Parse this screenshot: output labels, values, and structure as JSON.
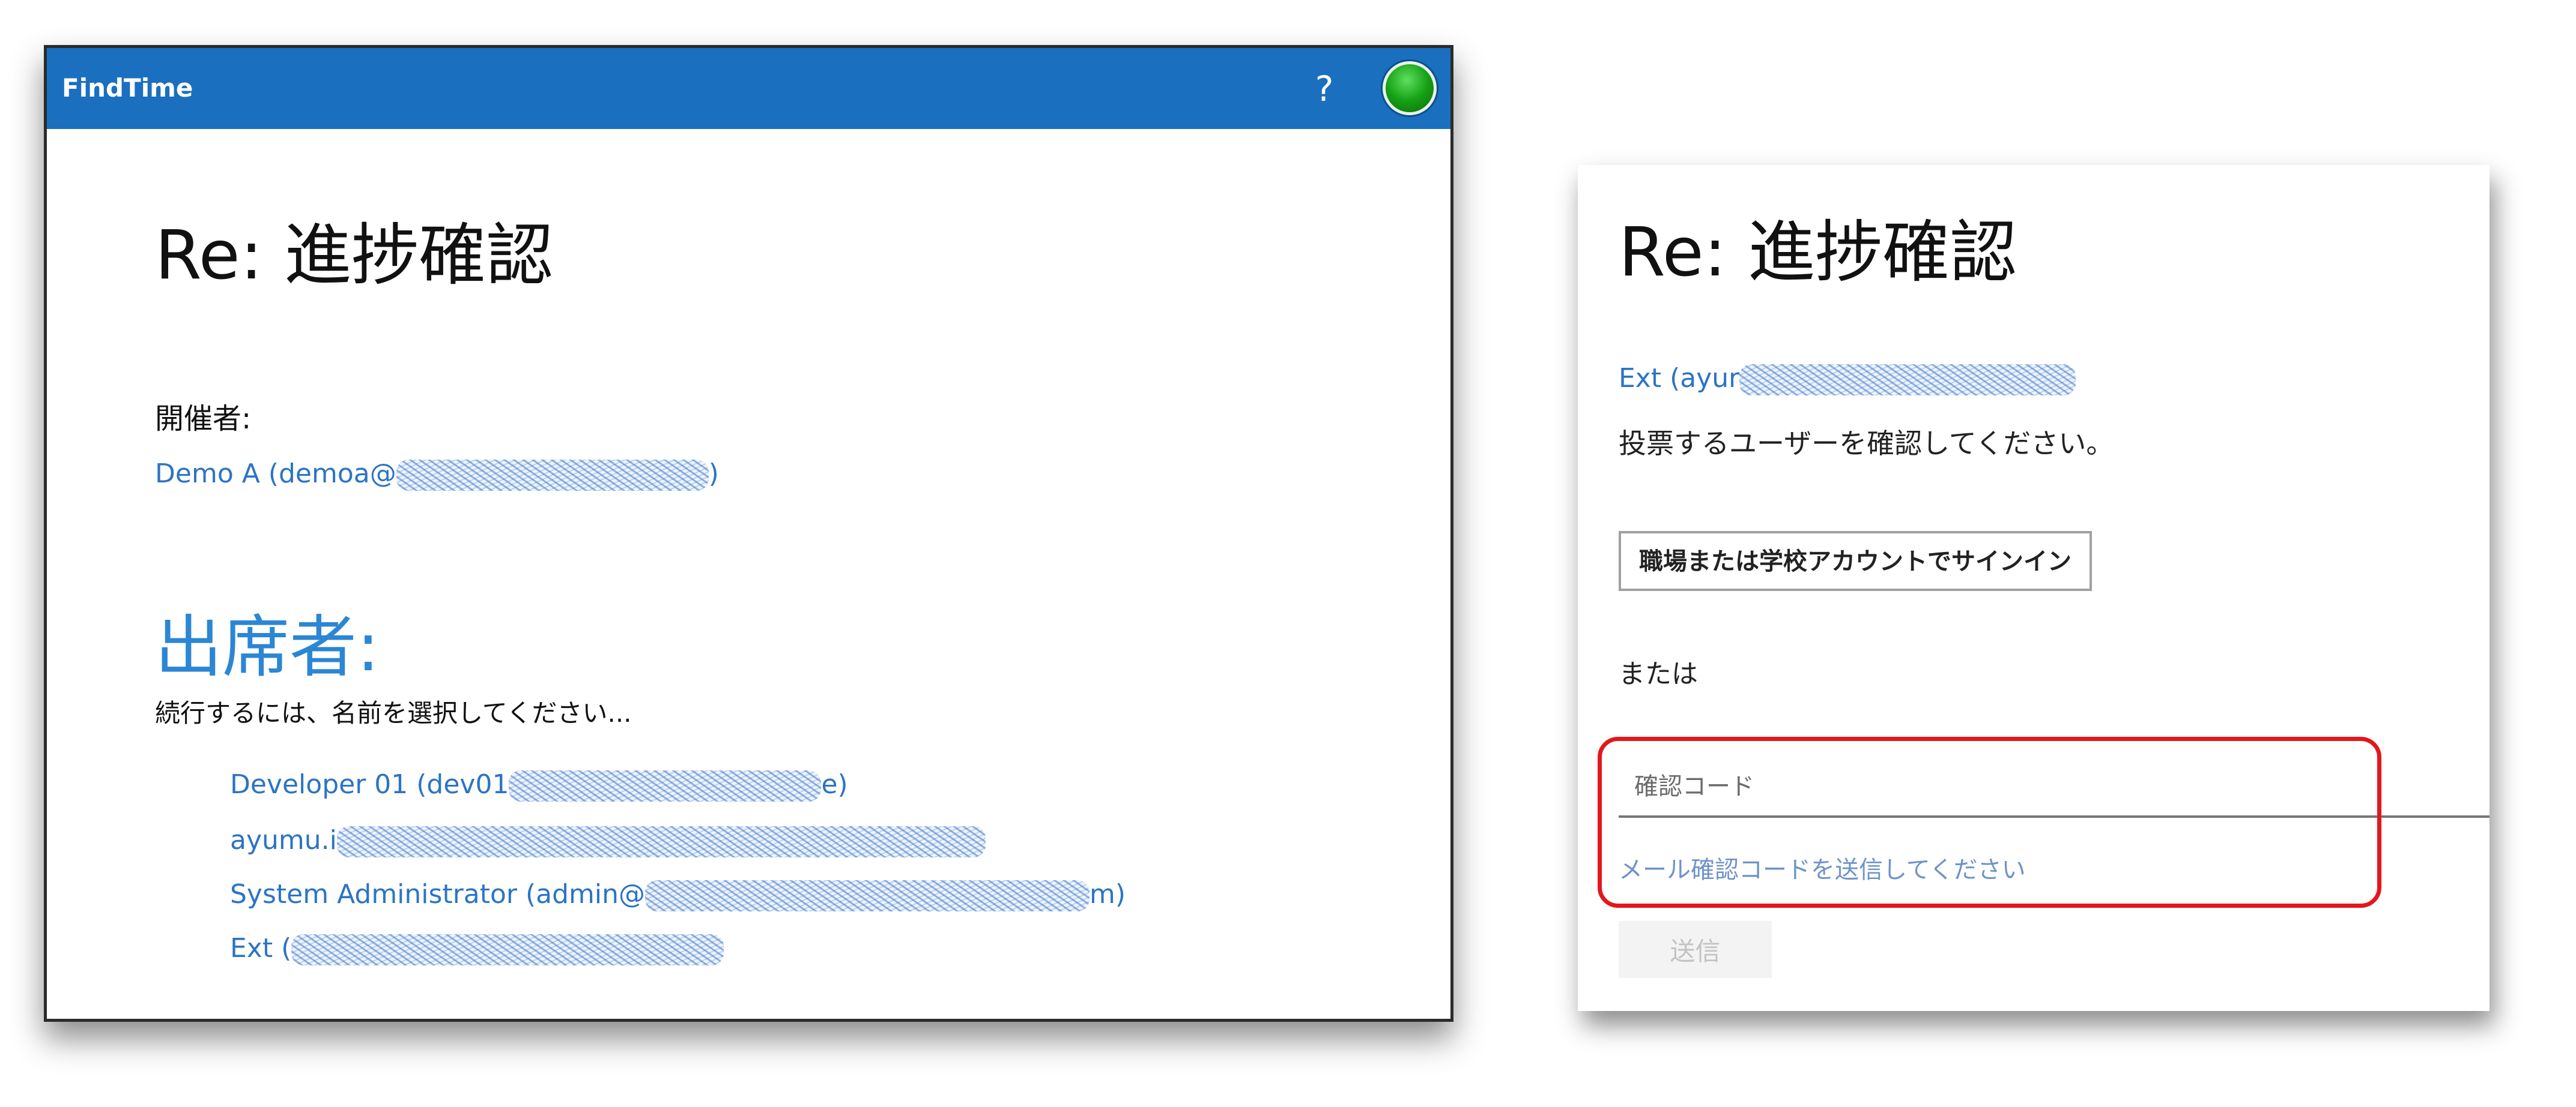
{
  "left_panel": {
    "app_title": "FindTime",
    "help_label": "?",
    "meeting_title": "Re: 進捗確認",
    "organizer_label": "開催者:",
    "organizer_value": "Demo A (demoa@",
    "organizer_value_suffix": ")",
    "attendees_heading": "出席者:",
    "instruction": "続行するには、名前を選択してください...",
    "attendees": [
      {
        "prefix": "Developer 01 (dev01",
        "suffix": "e)"
      },
      {
        "prefix": "ayumu.i",
        "suffix": ""
      },
      {
        "prefix": "System Administrator (admin@",
        "suffix": "m)"
      },
      {
        "prefix": "Ext (",
        "suffix": ""
      }
    ]
  },
  "right_panel": {
    "meeting_title": "Re: 進捗確認",
    "user_prefix": "Ext (ayur",
    "instruction": "投票するユーザーを確認してください。",
    "signin_button": "職場または学校アカウントでサインイン",
    "or_text": "または",
    "code_placeholder": "確認コード",
    "send_code_link": "メール確認コードを送信してください",
    "submit_button": "送信"
  },
  "colors": {
    "topbar": "#1a6fbf",
    "link": "#2b74c5",
    "highlight": "#e3171d"
  },
  "icons": {
    "help": "question-mark",
    "avatar": "green-circle-avatar"
  }
}
